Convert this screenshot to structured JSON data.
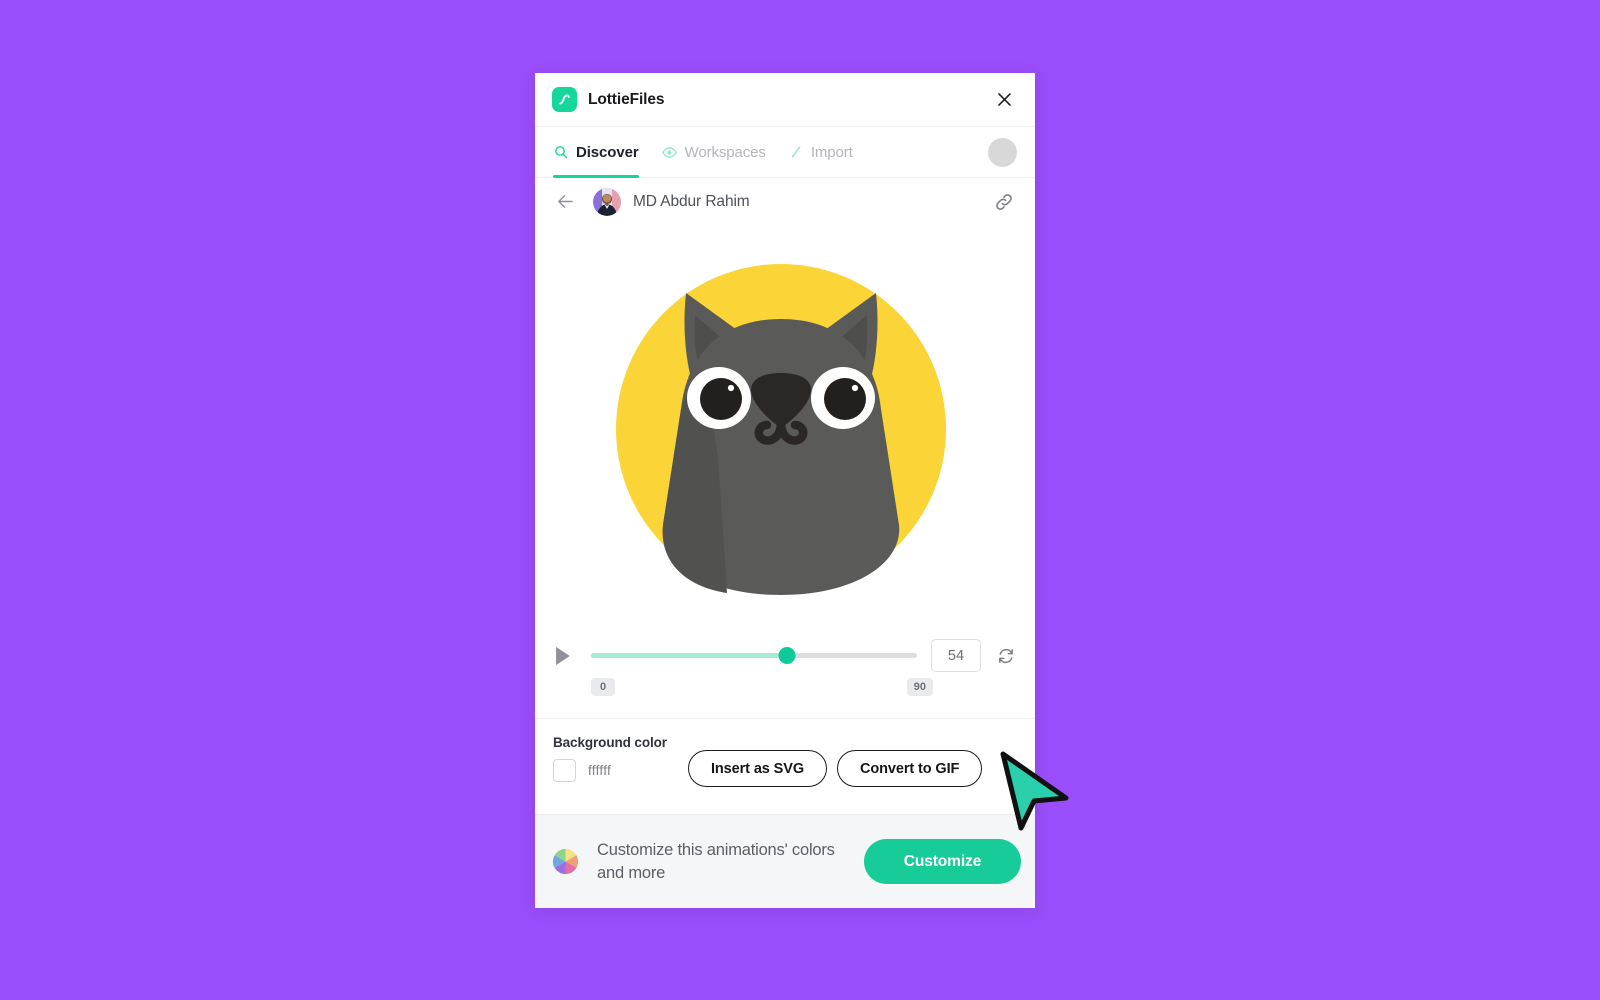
{
  "page": {
    "background_color": "#9a4dfa"
  },
  "titlebar": {
    "app_title": "LottieFiles",
    "logo_icon": "lottiefiles-logo-icon",
    "close_icon": "close-icon"
  },
  "tabs": [
    {
      "label": "Discover",
      "icon": "search-icon",
      "active": true
    },
    {
      "label": "Workspaces",
      "icon": "eye-icon",
      "active": false
    },
    {
      "label": "Import",
      "icon": "slash-pen-icon",
      "active": false
    }
  ],
  "author_row": {
    "back_icon": "arrow-left-icon",
    "avatar_icon": "author-avatar",
    "name": "MD Abdur Rahim",
    "link_icon": "link-icon"
  },
  "preview": {
    "name": "cat-animation-preview",
    "background_circle_color": "#fbd437",
    "body_color": "#5a5a58",
    "body_shadow_color": "#4e4e4c",
    "ear_inner_color": "#4e4e4c",
    "eye_white_color": "#ffffff",
    "eye_pupil_color": "#231f1d",
    "nose_color": "#2b2724"
  },
  "player": {
    "play_icon": "play-icon",
    "loop_icon": "loop-icon",
    "frame_value": "54",
    "range_min": "0",
    "range_max": "90",
    "progress_percent": 60,
    "track_color": "#dcdde1",
    "fill_color": "#a7ead8",
    "thumb_color": "#0ec99a"
  },
  "options": {
    "background_color_label": "Background color",
    "background_color_value": "ffffff",
    "swatch_color": "#ffffff",
    "insert_svg_label": "Insert as SVG",
    "convert_gif_label": "Convert to GIF"
  },
  "banner": {
    "wheel_icon": "color-wheel-icon",
    "text": "Customize this animations' colors and more",
    "button_label": "Customize",
    "button_color": "#18cc9a"
  },
  "cursor": {
    "icon": "mouse-pointer-icon",
    "fill_color": "#2ad0ac"
  }
}
